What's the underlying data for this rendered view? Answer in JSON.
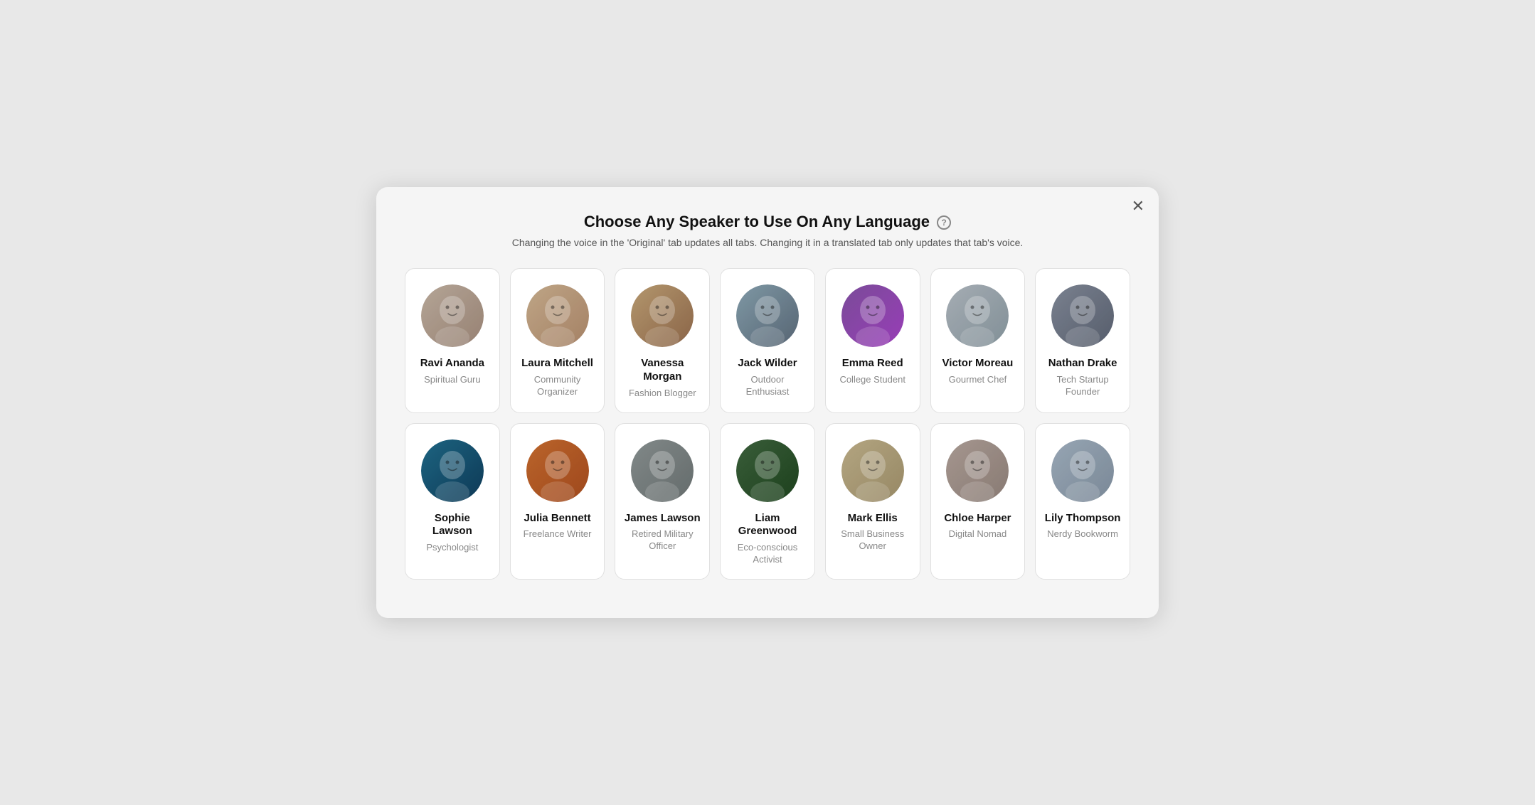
{
  "modal": {
    "title": "Choose Any Speaker to Use On Any Language",
    "subtitle": "Changing the voice in the 'Original' tab updates all tabs. Changing it in a translated tab only updates that tab's voice.",
    "close_label": "✕",
    "help_icon": "?"
  },
  "speakers_row1": [
    {
      "id": "ravi",
      "name": "Ravi Ananda",
      "role": "Spiritual Guru",
      "av_class": "av-ravi",
      "emoji": "🧔"
    },
    {
      "id": "laura",
      "name": "Laura Mitchell",
      "role": "Community Organizer",
      "av_class": "av-laura",
      "emoji": "👩"
    },
    {
      "id": "vanessa",
      "name": "Vanessa Morgan",
      "role": "Fashion Blogger",
      "av_class": "av-vanessa",
      "emoji": "👩"
    },
    {
      "id": "jack",
      "name": "Jack Wilder",
      "role": "Outdoor Enthusiast",
      "av_class": "av-jack",
      "emoji": "👨"
    },
    {
      "id": "emma",
      "name": "Emma Reed",
      "role": "College Student",
      "av_class": "av-emma",
      "emoji": "👩"
    },
    {
      "id": "victor",
      "name": "Victor Moreau",
      "role": "Gourmet Chef",
      "av_class": "av-victor",
      "emoji": "👨"
    },
    {
      "id": "nathan",
      "name": "Nathan Drake",
      "role": "Tech Startup Founder",
      "av_class": "av-nathan",
      "emoji": "👨"
    }
  ],
  "speakers_row2": [
    {
      "id": "sophie",
      "name": "Sophie Lawson",
      "role": "Psychologist",
      "av_class": "av-sophie",
      "emoji": "👩"
    },
    {
      "id": "julia",
      "name": "Julia Bennett",
      "role": "Freelance Writer",
      "av_class": "av-julia",
      "emoji": "👩"
    },
    {
      "id": "james",
      "name": "James Lawson",
      "role": "Retired Military Officer",
      "av_class": "av-james",
      "emoji": "👨"
    },
    {
      "id": "liam",
      "name": "Liam Greenwood",
      "role": "Eco-conscious Activist",
      "av_class": "av-liam",
      "emoji": "👨"
    },
    {
      "id": "mark",
      "name": "Mark Ellis",
      "role": "Small Business Owner",
      "av_class": "av-mark",
      "emoji": "👨"
    },
    {
      "id": "chloe",
      "name": "Chloe Harper",
      "role": "Digital Nomad",
      "av_class": "av-chloe",
      "emoji": "👩"
    },
    {
      "id": "lily",
      "name": "Lily Thompson",
      "role": "Nerdy Bookworm",
      "av_class": "av-lily",
      "emoji": "👩"
    }
  ]
}
